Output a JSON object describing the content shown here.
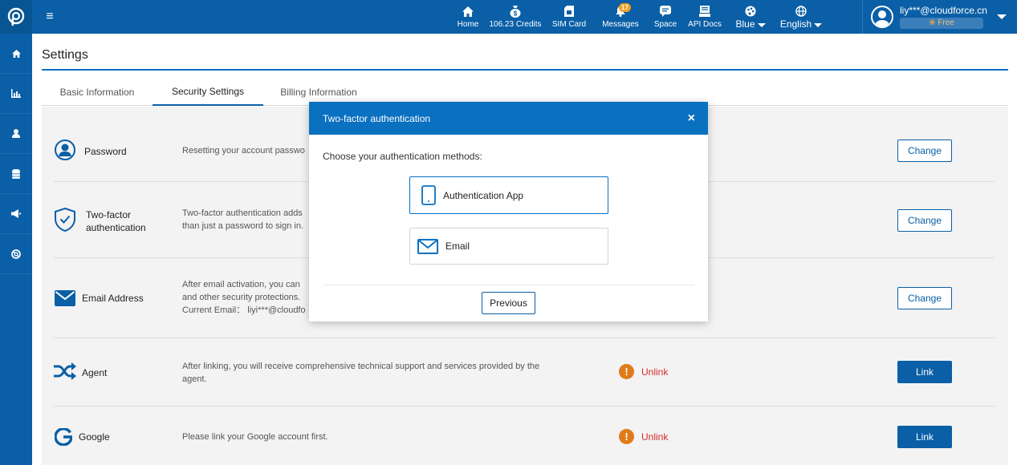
{
  "topbar": {
    "nav": [
      {
        "label": "Home",
        "icon": "home-icon"
      },
      {
        "label": "106.23 Credits",
        "icon": "money-bag-icon"
      },
      {
        "label": "SIM Card",
        "icon": "sim-card-icon"
      },
      {
        "label": "Messages",
        "icon": "bell-icon",
        "badge": "17"
      },
      {
        "label": "Space",
        "icon": "chat-icon"
      },
      {
        "label": "API Docs",
        "icon": "api-icon"
      },
      {
        "label": "Blue",
        "icon": "palette-icon"
      },
      {
        "label": "English",
        "icon": "globe-icon"
      }
    ],
    "user_email": "liy***@cloudforce.cn",
    "plan": "Free"
  },
  "sidebar": {
    "items": [
      "home-icon",
      "chart-icon",
      "user-icon",
      "database-icon",
      "megaphone-icon",
      "support-icon"
    ]
  },
  "page": {
    "title": "Settings",
    "tabs": [
      "Basic Information",
      "Security Settings",
      "Billing Information"
    ],
    "active_tab": "Security Settings"
  },
  "rows": [
    {
      "label": "Password",
      "desc": "Resetting your account passwo",
      "action": "Change",
      "icon": "user-circle-icon"
    },
    {
      "label": "Two-factor authentication",
      "label_line1": "Two-factor",
      "label_line2": "authentication",
      "desc_line1": "Two-factor authentication adds",
      "desc_line2": "than just a password to sign in.",
      "action": "Change",
      "icon": "shield-check-icon"
    },
    {
      "label": "Email Address",
      "desc_line1": "After email activation, you can",
      "desc_line2": "and other security protections.",
      "desc_line3": "Current Email： liyi***@cloudfo",
      "action": "Change",
      "icon": "envelope-icon"
    },
    {
      "label": "Agent",
      "desc_line1": "After linking, you will receive comprehensive technical support and services provided by the",
      "desc_line2": "agent.",
      "status": "Unlink",
      "action": "Link",
      "icon": "shuffle-icon"
    },
    {
      "label": "Google",
      "desc": "Please link your Google account first.",
      "status": "Unlink",
      "action": "Link",
      "icon": "google-icon"
    }
  ],
  "modal": {
    "title": "Two-factor authentication",
    "close": "×",
    "subtitle": "Choose your authentication methods:",
    "options": [
      {
        "label": "Authentication App",
        "icon": "mobile-phone-icon"
      },
      {
        "label": "Email",
        "icon": "envelope-icon"
      }
    ],
    "previous_label": "Previous"
  },
  "colors": {
    "brand_blue": "#0a5fa6",
    "header_blue": "#0a70c0",
    "warn_orange": "#e07b1a",
    "unlink_red": "#d42a2a",
    "badge_orange": "#f0a020"
  }
}
